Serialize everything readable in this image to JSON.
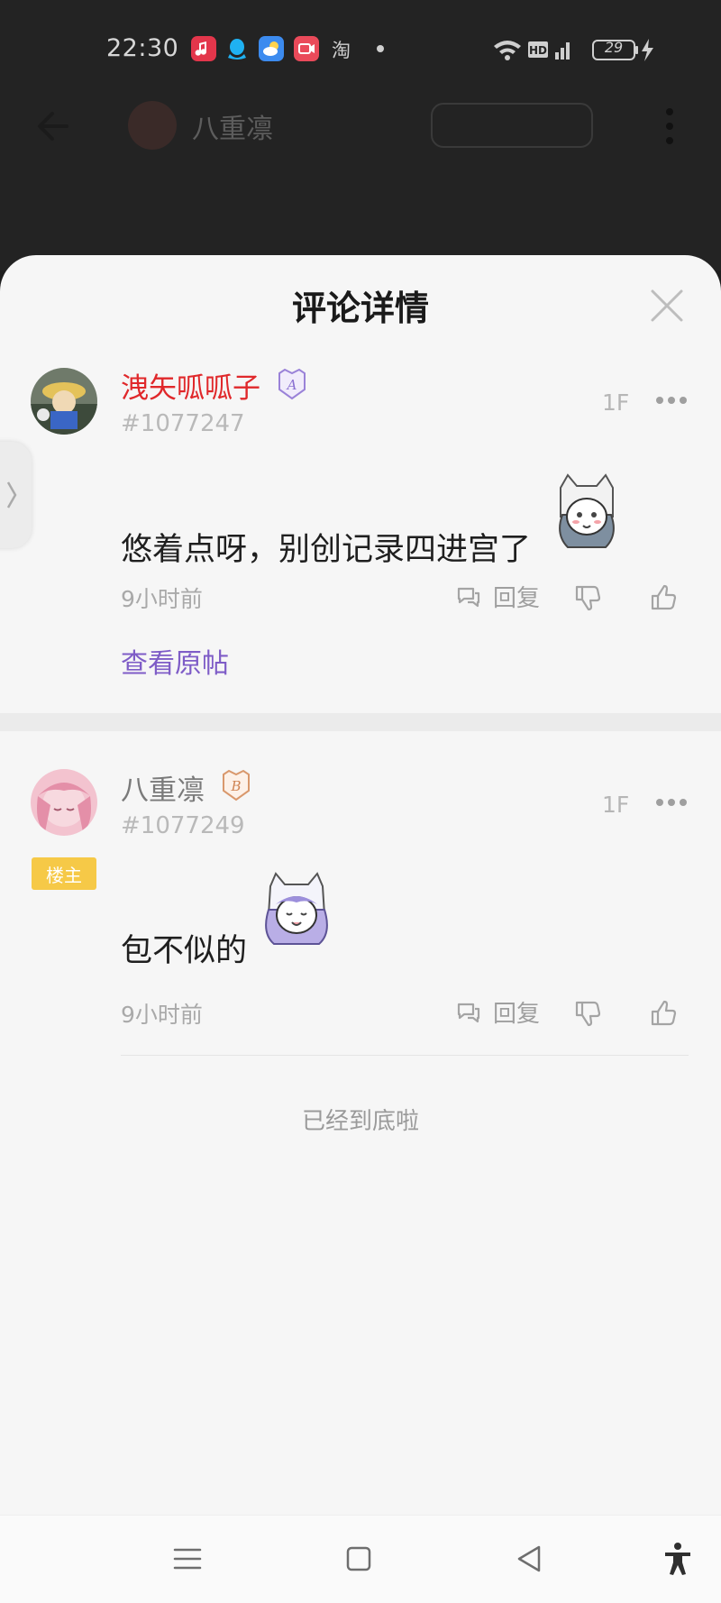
{
  "status_bar": {
    "time": "22:30",
    "taobao_label": "淘",
    "battery": "29",
    "icons": [
      "music-app-icon",
      "qq-app-icon",
      "weather-app-icon",
      "video-app-icon",
      "wifi-icon",
      "hd-icon",
      "signal-icon",
      "battery-icon",
      "charging-icon"
    ]
  },
  "background_page": {
    "author_name": "八重凛"
  },
  "sheet": {
    "title": "评论详情"
  },
  "comments": [
    {
      "username": "洩矢呱呱子",
      "username_color": "#e0282b",
      "level_badge": "A",
      "user_id": "#1077247",
      "floor": "1F",
      "text": "悠着点呀，别创记录四进宫了",
      "time": "9小时前",
      "reply_label": "回复",
      "view_original": "查看原帖"
    },
    {
      "username": "八重凛",
      "username_color": "#7a7a7a",
      "level_badge": "B",
      "user_id": "#1077249",
      "floor": "1F",
      "op_tag": "楼主",
      "text": "包不似的",
      "time": "9小时前",
      "reply_label": "回复"
    }
  ],
  "footer": {
    "end_text": "已经到底啦"
  },
  "colors": {
    "accent_purple": "#7e5cc7",
    "op_tag": "#f6c947",
    "sheet_bg": "#f6f6f6"
  }
}
